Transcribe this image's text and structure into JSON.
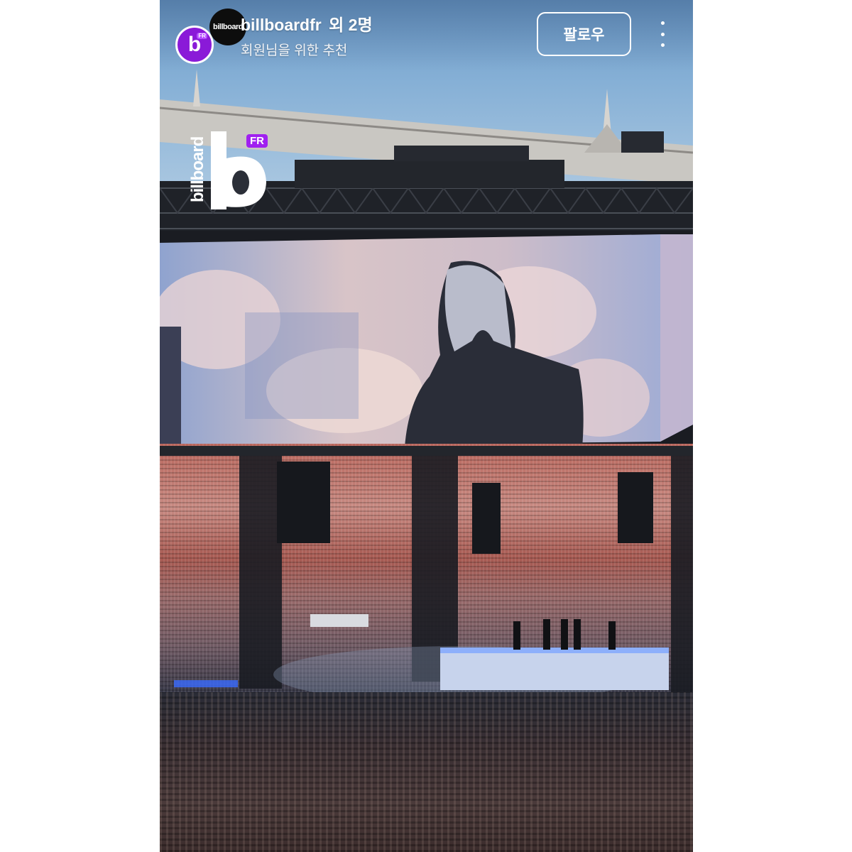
{
  "header": {
    "account_name": "billboardfr",
    "others": "외 2명",
    "subtitle": "회원님을 위한 추천",
    "follow_label": "팔로우",
    "more_icon": "more-vertical-icon"
  },
  "avatars": {
    "back_text": "billboard",
    "front_letter": "b",
    "front_tag": "FR"
  },
  "watermark": {
    "word": "billboard",
    "letter": "b",
    "tag": "FR"
  },
  "colors": {
    "brand_purple": "#8a1ad8",
    "text": "#ffffff"
  }
}
